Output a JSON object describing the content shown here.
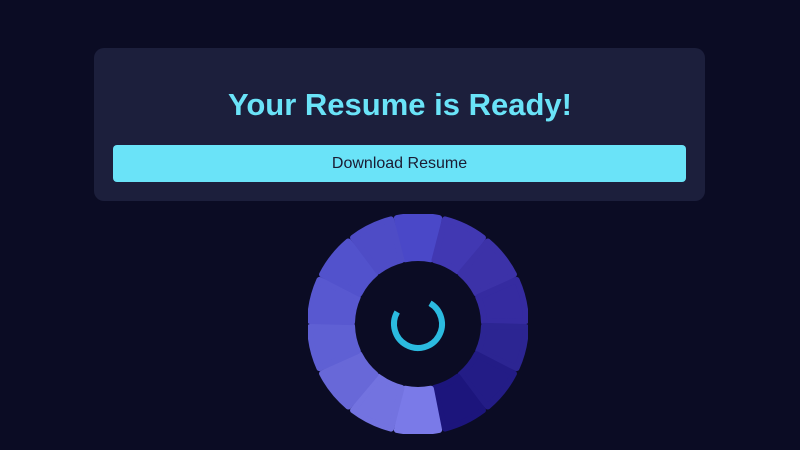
{
  "card": {
    "title": "Your Resume is Ready!",
    "download_label": "Download Resume"
  },
  "colors": {
    "background": "#0b0c24",
    "card": "#1c1f3c",
    "accent": "#6ae3f8",
    "spinner_arc": "#2bbbe0"
  },
  "loader": {
    "segment_colors": [
      "#4a48c8",
      "#4138b2",
      "#3c32a8",
      "#352ba0",
      "#2c2592",
      "#231c86",
      "#1c157c",
      "#7a7ae8",
      "#7373e0",
      "#6868d8",
      "#5f60d4",
      "#5858d0",
      "#5252cc",
      "#4e4cc6"
    ]
  }
}
